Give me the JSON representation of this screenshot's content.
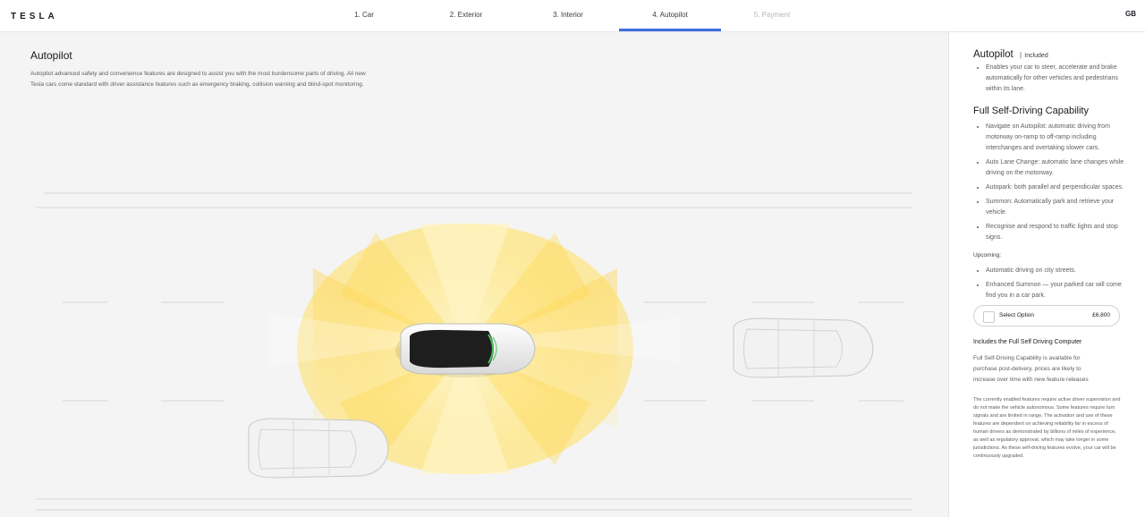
{
  "header": {
    "logo_text": "TESLA",
    "steps": [
      {
        "label": "1. Car",
        "state": "default"
      },
      {
        "label": "2. Exterior",
        "state": "default"
      },
      {
        "label": "3. Interior",
        "state": "default"
      },
      {
        "label": "4. Autopilot",
        "state": "active"
      },
      {
        "label": "5. Payment",
        "state": "disabled"
      }
    ],
    "region": "GB"
  },
  "hero": {
    "title": "Autopilot",
    "description": "Autopilot advanced safety and convenience features are designed to assist you with the most burdensome parts of driving. All new Tesla cars come standard with driver assistance features such as emergency braking, collision warning and blind-spot monitoring."
  },
  "panel": {
    "autopilot": {
      "title": "Autopilot",
      "separator": "|",
      "badge": "Included",
      "features": [
        "Enables your car to steer, accelerate and brake automatically for other vehicles and pedestrians within its lane."
      ]
    },
    "fsd": {
      "title": "Full Self-Driving Capability",
      "features": [
        "Navigate on Autopilot: automatic driving from motorway on-ramp to off-ramp including interchanges and overtaking slower cars.",
        "Auto Lane Change: automatic lane changes while driving on the motorway.",
        "Autopark: both parallel and perpendicular spaces.",
        "Summon: Automatically park and retrieve your vehicle.",
        "Recognise and respond to traffic lights and stop signs."
      ],
      "upcoming_label": "Upcoming:",
      "upcoming": [
        "Automatic driving on city streets.",
        "Enhanced Summon — your parked car will come find you in a car park."
      ],
      "option": {
        "label": "Select Option",
        "price": "£6,800",
        "checked": false
      },
      "includes_computer": "Includes the Full Self Driving Computer",
      "post_delivery": "Full Self-Driving Capability is available for purchase post-delivery, prices are likely to increase over time with new feature releases",
      "disclaimer": "The currently enabled features require active driver supervision and do not make the vehicle autonomous. Some features require turn signals and are limited in range. The activation and use of these features are dependent on achieving reliability far in excess of human drivers as demonstrated by billions of miles of experience, as well as regulatory approval, which may take longer in some jurisdictions. As these self-driving features evolve, your car will be continuously upgraded."
    }
  },
  "colors": {
    "accent": "#3e6ae1",
    "sensor_yellow": "#ffd84a",
    "background": "#f4f4f4"
  }
}
